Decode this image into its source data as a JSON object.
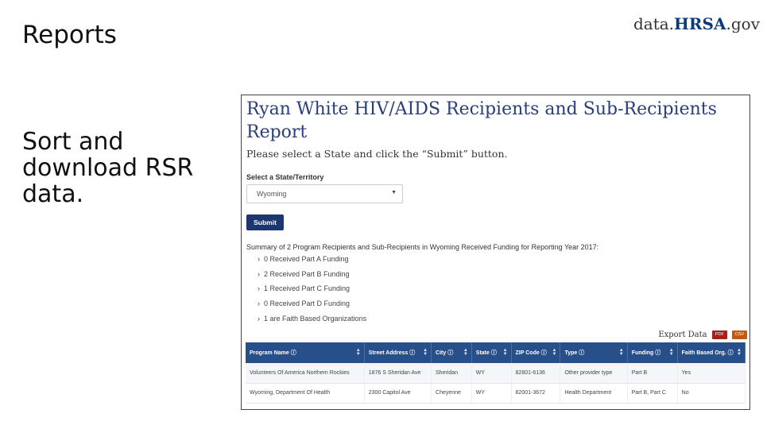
{
  "slide": {
    "title": "Reports",
    "body": "Sort and download RSR data."
  },
  "brand": {
    "prefix": "data.",
    "highlight": "HRSA",
    "suffix": ".gov",
    "accent_color": "#0b3a78"
  },
  "report": {
    "title": "Ryan White HIV/AIDS Recipients and Sub-Recipients Report",
    "subtitle": "Please select a State and click the “Submit” button.",
    "select_label": "Select a State/Territory",
    "selected_state": "Wyoming",
    "submit_label": "Submit",
    "summary": "Summary of 2 Program Recipients and Sub-Recipients in Wyoming Received Funding for Reporting Year 2017:",
    "funding_items": [
      "0 Received Part A Funding",
      "2 Received Part B Funding",
      "1 Received Part C Funding",
      "0 Received Part D Funding",
      "1 are Faith Based Organizations"
    ],
    "export": {
      "label": "Export Data",
      "pdf": "PDF",
      "csv": "CSV"
    },
    "table": {
      "headers": [
        "Program Name",
        "Street Address",
        "City",
        "State",
        "ZIP Code",
        "Type",
        "Funding",
        "Faith Based Org."
      ],
      "rows": [
        [
          "Volunteers Of America Northern Rockies",
          "1876 S Sheridan Ave",
          "Sheridan",
          "WY",
          "82801-6136",
          "Other provider type",
          "Part B",
          "Yes"
        ],
        [
          "Wyoming, Department Of Health",
          "2300 Capitol Ave",
          "Cheyenne",
          "WY",
          "82001-3672",
          "Health Department",
          "Part B, Part C",
          "No"
        ]
      ]
    },
    "colors": {
      "header_bg": "#274f8a",
      "title": "#2a3f7a",
      "button": "#1c3770"
    }
  }
}
